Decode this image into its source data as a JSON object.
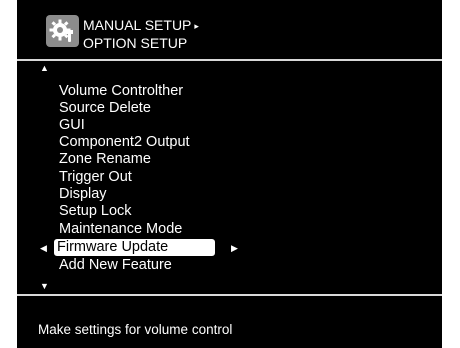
{
  "header": {
    "icon": "gear-wrench-icon",
    "breadcrumb_parent": "MANUAL SETUP",
    "breadcrumb_arrow": "▸",
    "title": "OPTION SETUP"
  },
  "menu": {
    "scroll_up_indicator": "▲",
    "scroll_down_indicator": "▼",
    "items": [
      {
        "label": "Volume Controlther"
      },
      {
        "label": "Source Delete"
      },
      {
        "label": "GUI"
      },
      {
        "label": "Component2 Output"
      },
      {
        "label": "Zone Rename"
      },
      {
        "label": "Trigger Out"
      },
      {
        "label": "Display"
      },
      {
        "label": "Setup Lock"
      },
      {
        "label": "Maintenance Mode"
      },
      {
        "label": "Firmware Update"
      },
      {
        "label": "Add New Feature"
      }
    ],
    "selected_item": "Firmware Update",
    "selected_left_arrow": "◀",
    "selected_right_arrow": "▶"
  },
  "status": {
    "description": "Make settings for volume control"
  },
  "colors": {
    "background": "#000000",
    "text": "#ffffff",
    "highlight": "#ffffff",
    "icon_box": "#8c8c8c"
  }
}
